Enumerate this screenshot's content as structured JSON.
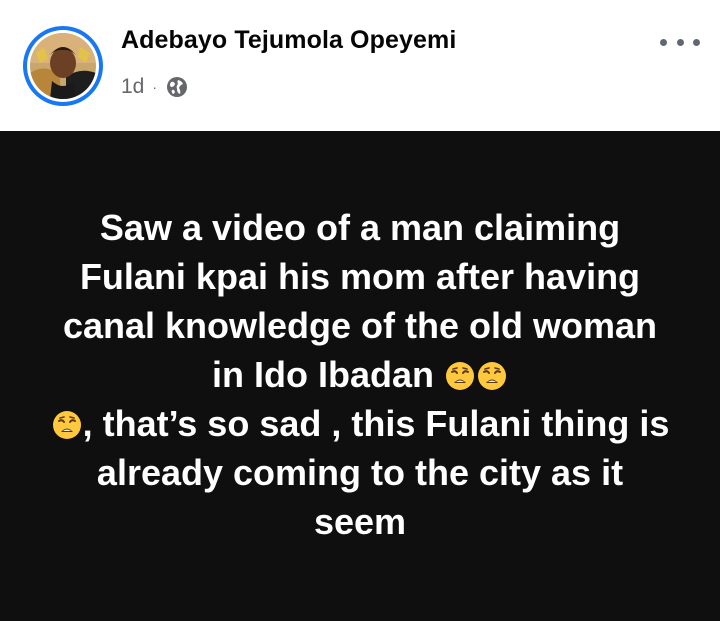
{
  "post": {
    "author": "Adebayo Tejumola Opeyemi",
    "time": "1d",
    "separator": "·",
    "privacy_icon": "globe-icon",
    "more_icon": "more-horizontal-icon",
    "text_part1": "Saw a video of a man claiming Fulani kpai his mom after having canal knowledge of the old woman in Ido Ibadan ",
    "text_part2": ", that’s so sad , this Fulani thing is already coming to the city as it seem",
    "emoji": "tired-face-emoji",
    "emoji_count": 3,
    "background_color": "#0f0f0f",
    "text_color": "#ffffff",
    "ring_color": "#1877f2"
  }
}
